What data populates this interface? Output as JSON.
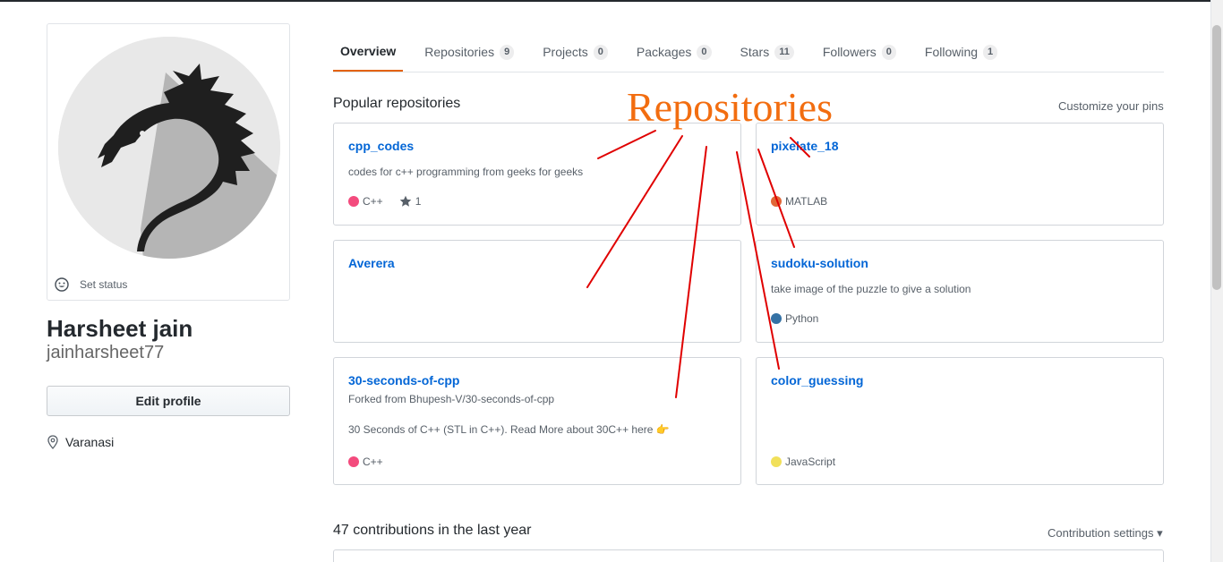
{
  "profile": {
    "set_status": "Set status",
    "full_name": "Harsheet jain",
    "username": "jainharsheet77",
    "edit_profile": "Edit profile",
    "location": "Varanasi"
  },
  "tabs": [
    {
      "label": "Overview",
      "count": null,
      "selected": true
    },
    {
      "label": "Repositories",
      "count": "9"
    },
    {
      "label": "Projects",
      "count": "0"
    },
    {
      "label": "Packages",
      "count": "0"
    },
    {
      "label": "Stars",
      "count": "11"
    },
    {
      "label": "Followers",
      "count": "0"
    },
    {
      "label": "Following",
      "count": "1"
    }
  ],
  "popular": {
    "title": "Popular repositories",
    "customize": "Customize your pins"
  },
  "repos": [
    {
      "name": "cpp_codes",
      "description": "codes for c++ programming from geeks for geeks",
      "language": "C++",
      "lang_color": "#f34b7d",
      "stars": "1"
    },
    {
      "name": "pixelate_18",
      "language": "MATLAB",
      "lang_color": "#e16737"
    },
    {
      "name": "Averera"
    },
    {
      "name": "sudoku-solution",
      "description": "take image of the puzzle to give a solution",
      "language": "Python",
      "lang_color": "#3572A5"
    },
    {
      "name": "30-seconds-of-cpp",
      "forked_from": "Forked from Bhupesh-V/30-seconds-of-cpp",
      "description": "30 Seconds of C++ (STL in C++). Read More about 30C++ here 👉",
      "language": "C++",
      "lang_color": "#f34b7d"
    },
    {
      "name": "color_guessing",
      "language": "JavaScript",
      "lang_color": "#f1e05a"
    }
  ],
  "contributions": {
    "title": "47 contributions in the last year",
    "settings": "Contribution settings ▾"
  },
  "annotation": {
    "text": "Repositories",
    "color": "#f26d10",
    "line_color": "#e00000"
  },
  "icons": [
    "smiley-icon",
    "location-pin-icon",
    "star-icon"
  ]
}
